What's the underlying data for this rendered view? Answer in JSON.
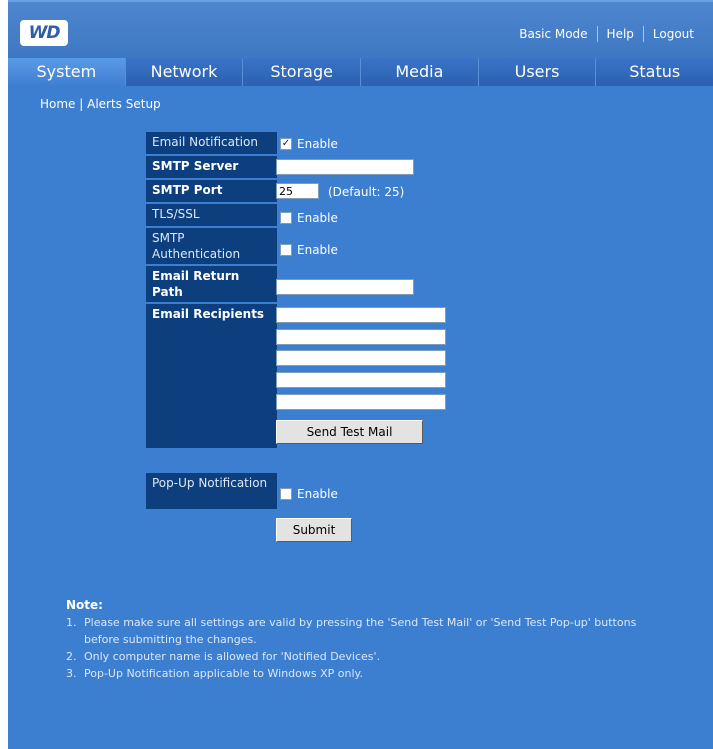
{
  "header": {
    "logo": "WD",
    "links": [
      "Basic Mode",
      "Help",
      "Logout"
    ]
  },
  "nav": {
    "tabs": [
      "System",
      "Network",
      "Storage",
      "Media",
      "Users",
      "Status"
    ],
    "active": "System"
  },
  "breadcrumb": "Home | Alerts Setup",
  "form": {
    "email_notification": {
      "label": "Email Notification",
      "enable_label": "Enable",
      "checked": true
    },
    "smtp_server": {
      "label": "SMTP Server",
      "value": ""
    },
    "smtp_port": {
      "label": "SMTP Port",
      "value": "25",
      "hint": "(Default: 25)"
    },
    "tls_ssl": {
      "label": "TLS/SSL",
      "enable_label": "Enable",
      "checked": false
    },
    "smtp_auth": {
      "label": "SMTP Authentication",
      "enable_label": "Enable",
      "checked": false
    },
    "email_return_path": {
      "label": "Email Return Path",
      "value": ""
    },
    "email_recipients": {
      "label": "Email Recipients",
      "values": [
        "",
        "",
        "",
        "",
        ""
      ]
    },
    "send_test_mail_label": "Send Test Mail",
    "popup_notification": {
      "label": "Pop-Up Notification",
      "enable_label": "Enable",
      "checked": false
    },
    "submit_label": "Submit"
  },
  "note": {
    "title": "Note:",
    "items": [
      "Please make sure all settings are valid by pressing the 'Send Test Mail' or 'Send Test Pop-up' buttons before submitting the changes.",
      "Only computer name is allowed for 'Notified Devices'.",
      "Pop-Up Notification applicable to Windows XP only."
    ]
  },
  "colors": {
    "background": "#3c7fd1",
    "label_bg": "#0d3f7e",
    "nav_bg": "#2a5fb0"
  }
}
